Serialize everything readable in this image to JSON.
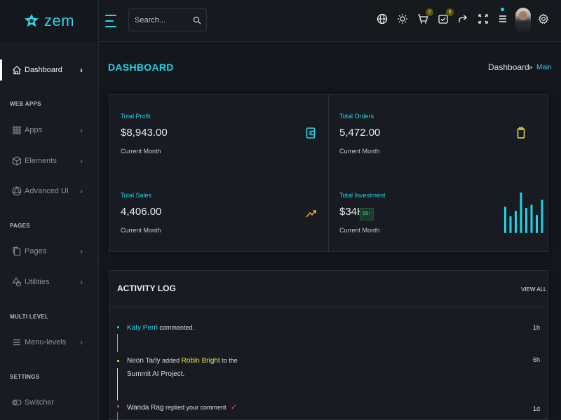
{
  "brand": {
    "name": "zem"
  },
  "search": {
    "placeholder": "Search..."
  },
  "header": {
    "cart_badge": "2",
    "tasks_badge": "5"
  },
  "sidebar": {
    "dashboard": "Dashboard",
    "section_web_apps": "WEB APPS",
    "apps": "Apps",
    "elements": "Elements",
    "advanced_ui": "Advanced UI",
    "section_pages": "PAGES",
    "pages": "Pages",
    "utilities": "Utilities",
    "section_multi_level": "MULTI LEVEL",
    "menu_levels": "Menu-levels",
    "section_settings": "SETTINGS",
    "switcher": "Switcher",
    "chevron": "›"
  },
  "page": {
    "title": "DASHBOARD",
    "breadcrumb_root": "Dashboard",
    "breadcrumb_sep": "»",
    "breadcrumb_leaf": "Main"
  },
  "stats": {
    "profit": {
      "label": "Total Profit",
      "value": "$8,943.00",
      "sub": "Current Month"
    },
    "orders": {
      "label": "Total Orders",
      "value": "5,472.00",
      "sub": "Current Month"
    },
    "sales": {
      "label": "Total Sales",
      "value": "4,406.00",
      "sub": "Current Month"
    },
    "investment": {
      "label": "Total Investment",
      "value": "$34K",
      "sub": "Current Month",
      "trend": "55↑"
    }
  },
  "sparkline": {
    "values": [
      0.65,
      0.42,
      0.55,
      1.0,
      0.62,
      0.7,
      0.45,
      0.82
    ]
  },
  "activity": {
    "title": "ACTIVITY LOG",
    "view_all": "VIEW ALL",
    "items": [
      {
        "name": "Katy Perri",
        "text": "commented.",
        "time": "1h",
        "color": "#2ad3e6"
      },
      {
        "name": "Neon Tarly",
        "mid": "added",
        "target": "Robin Bright",
        "tail": "to the",
        "line2": "Summit AI Project.",
        "time": "6h",
        "color": "#e9e14a"
      },
      {
        "name": "Wanda Rag",
        "text": "replied your comment",
        "time": "1d",
        "color": "#e05a45"
      }
    ]
  },
  "colors": {
    "accent": "#24d2e6",
    "yellow": "#e9e14a",
    "red": "#e05a45",
    "bg": "#14171c"
  }
}
